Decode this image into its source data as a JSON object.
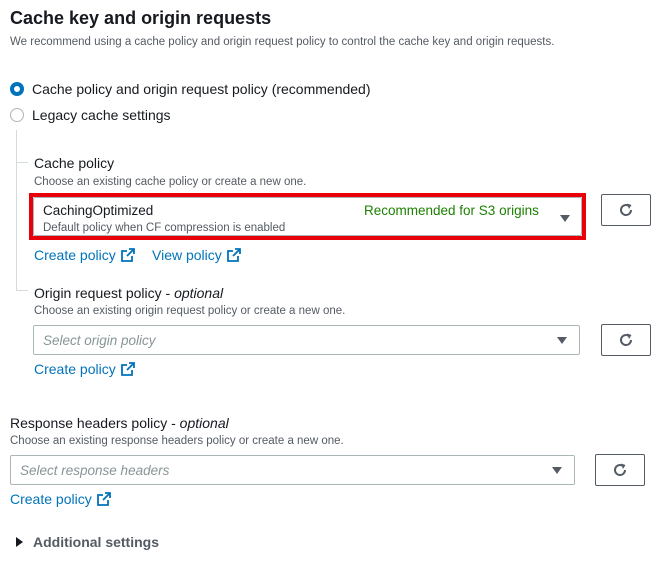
{
  "section": {
    "title": "Cache key and origin requests",
    "description": "We recommend using a cache policy and origin request policy to control the cache key and origin requests."
  },
  "radios": [
    {
      "label": "Cache policy and origin request policy (recommended)",
      "checked": true
    },
    {
      "label": "Legacy cache settings",
      "checked": false
    }
  ],
  "cache_policy": {
    "label": "Cache policy",
    "description": "Choose an existing cache policy or create a new one.",
    "selected": {
      "name": "CachingOptimized",
      "description": "Default policy when CF compression is enabled",
      "tag": "Recommended for S3 origins"
    },
    "create_link": "Create policy",
    "view_link": "View policy"
  },
  "origin_request_policy": {
    "label": "Origin request policy",
    "label_suffix": "optional",
    "description": "Choose an existing origin request policy or create a new one.",
    "placeholder": "Select origin policy",
    "create_link": "Create policy"
  },
  "response_headers_policy": {
    "label": "Response headers policy",
    "label_suffix": "optional",
    "description": "Choose an existing response headers policy or create a new one.",
    "placeholder": "Select response headers",
    "create_link": "Create policy"
  },
  "additional_settings": {
    "label": "Additional settings"
  },
  "colors": {
    "link": "#0073bb",
    "recommended_tag": "#1d8102",
    "highlight_border": "#e8000b",
    "radio_selected": "#0073bb"
  },
  "icons": {
    "refresh": "refresh-icon",
    "external_link": "external-link-icon",
    "dropdown": "caret-down-icon",
    "expand": "caret-right-icon"
  }
}
